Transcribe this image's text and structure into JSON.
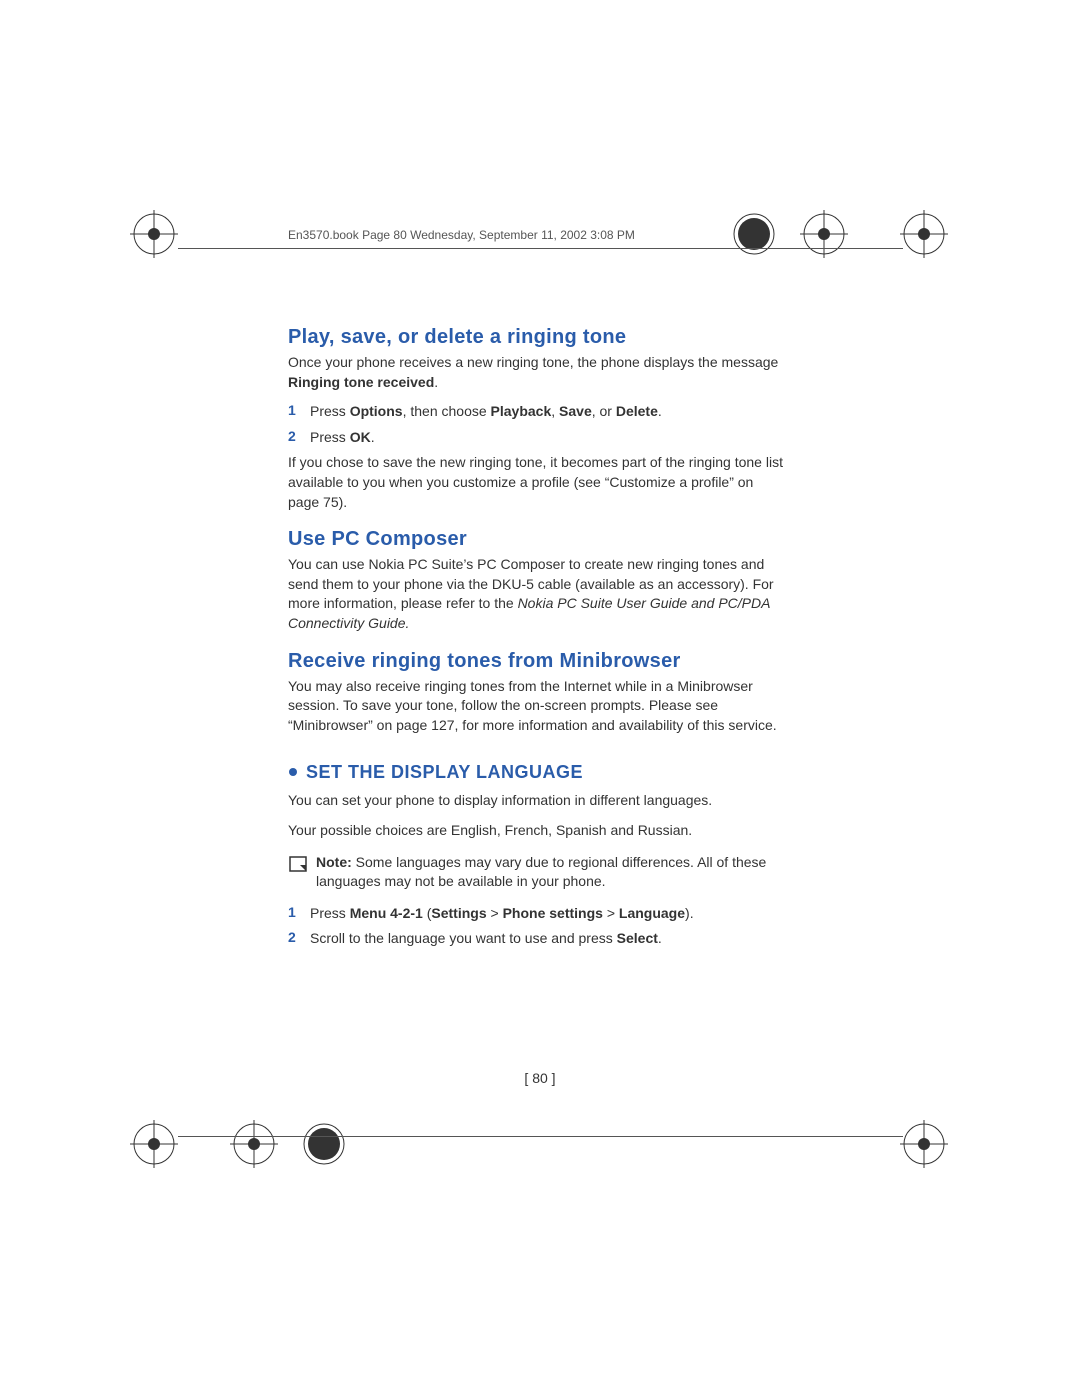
{
  "header": "En3570.book  Page 80  Wednesday, September 11, 2002  3:08 PM",
  "h1": "Play, save, or delete a ringing tone",
  "p1a": "Once your phone receives a new ringing tone, the phone displays the message ",
  "p1b": "Ringing tone received",
  "p1c": ".",
  "s1n": "1",
  "s1a": "Press ",
  "s1b": "Options",
  "s1c": ", then choose ",
  "s1d": "Playback",
  "s1e": ", ",
  "s1f": "Save",
  "s1g": ", or ",
  "s1h": "Delete",
  "s1i": ".",
  "s2n": "2",
  "s2a": "Press ",
  "s2b": "OK",
  "s2c": ".",
  "p2": "If you chose to save the new ringing tone, it becomes part of the ringing tone list available to you when you customize a profile (see “Customize a profile” on page 75).",
  "h2": "Use PC Composer",
  "p3a": "You can use Nokia PC Suite’s PC Composer to create new ringing tones and send them to your phone via the DKU-5 cable (available as an accessory). For more information, please refer to the ",
  "p3b": "Nokia PC Suite User Guide and PC/PDA Connectivity Guide.",
  "h3": "Receive ringing tones from Minibrowser",
  "p4": "You may also receive ringing tones from the Internet while in a Minibrowser session. To save your tone, follow the on-screen prompts. Please see “Minibrowser” on page 127, for more information and availability of this service.",
  "sec1": "SET THE DISPLAY LANGUAGE",
  "p5": "You can set your phone to display information in different languages.",
  "p6": "Your possible choices are English, French, Spanish and Russian.",
  "note_b": "Note: ",
  "note_t": "Some languages may vary due to regional differences. All of these languages may not be available in your phone.",
  "s3n": "1",
  "s3a": "Press ",
  "s3b": "Menu 4-2-1",
  "s3c": " (",
  "s3d": "Settings",
  "s3e": " > ",
  "s3f": "Phone settings",
  "s3g": " > ",
  "s3h": "Language",
  "s3i": ").",
  "s4n": "2",
  "s4a": "Scroll to the language you want to use and press ",
  "s4b": "Select",
  "s4c": ".",
  "page_num": "[ 80 ]"
}
